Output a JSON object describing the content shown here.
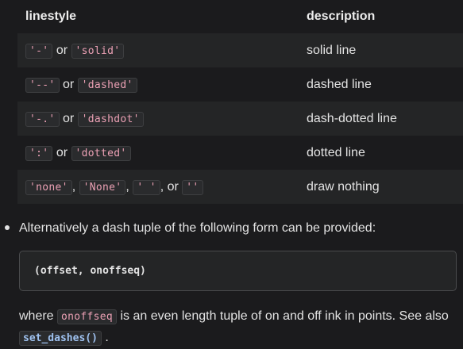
{
  "table": {
    "headers": [
      "linestyle",
      "description"
    ],
    "rows": [
      {
        "codes": [
          "'-'",
          "'solid'"
        ],
        "separators": [
          " or "
        ],
        "description": "solid line"
      },
      {
        "codes": [
          "'--'",
          "'dashed'"
        ],
        "separators": [
          " or "
        ],
        "description": "dashed line"
      },
      {
        "codes": [
          "'-.'",
          "'dashdot'"
        ],
        "separators": [
          " or "
        ],
        "description": "dash-dotted line"
      },
      {
        "codes": [
          "':'",
          "'dotted'"
        ],
        "separators": [
          " or "
        ],
        "description": "dotted line"
      },
      {
        "codes": [
          "'none'",
          "'None'",
          "' '",
          "''"
        ],
        "separators": [
          ", ",
          ", ",
          ", or "
        ],
        "description": "draw nothing"
      }
    ]
  },
  "bullet": {
    "text": "Alternatively a dash tuple of the following form can be provided:"
  },
  "code_block": {
    "text": "(offset, onoffseq)"
  },
  "paragraph": {
    "prefix": "where ",
    "code": "onoffseq",
    "middle": " is an even length tuple of on and off ink in points. See also",
    "link": "set_dashes()",
    "suffix": " ."
  },
  "colors": {
    "background": "#1b1b1d",
    "stripe": "#242526",
    "inline_code": "#eba0b4",
    "link_code": "#9fc2f0"
  }
}
